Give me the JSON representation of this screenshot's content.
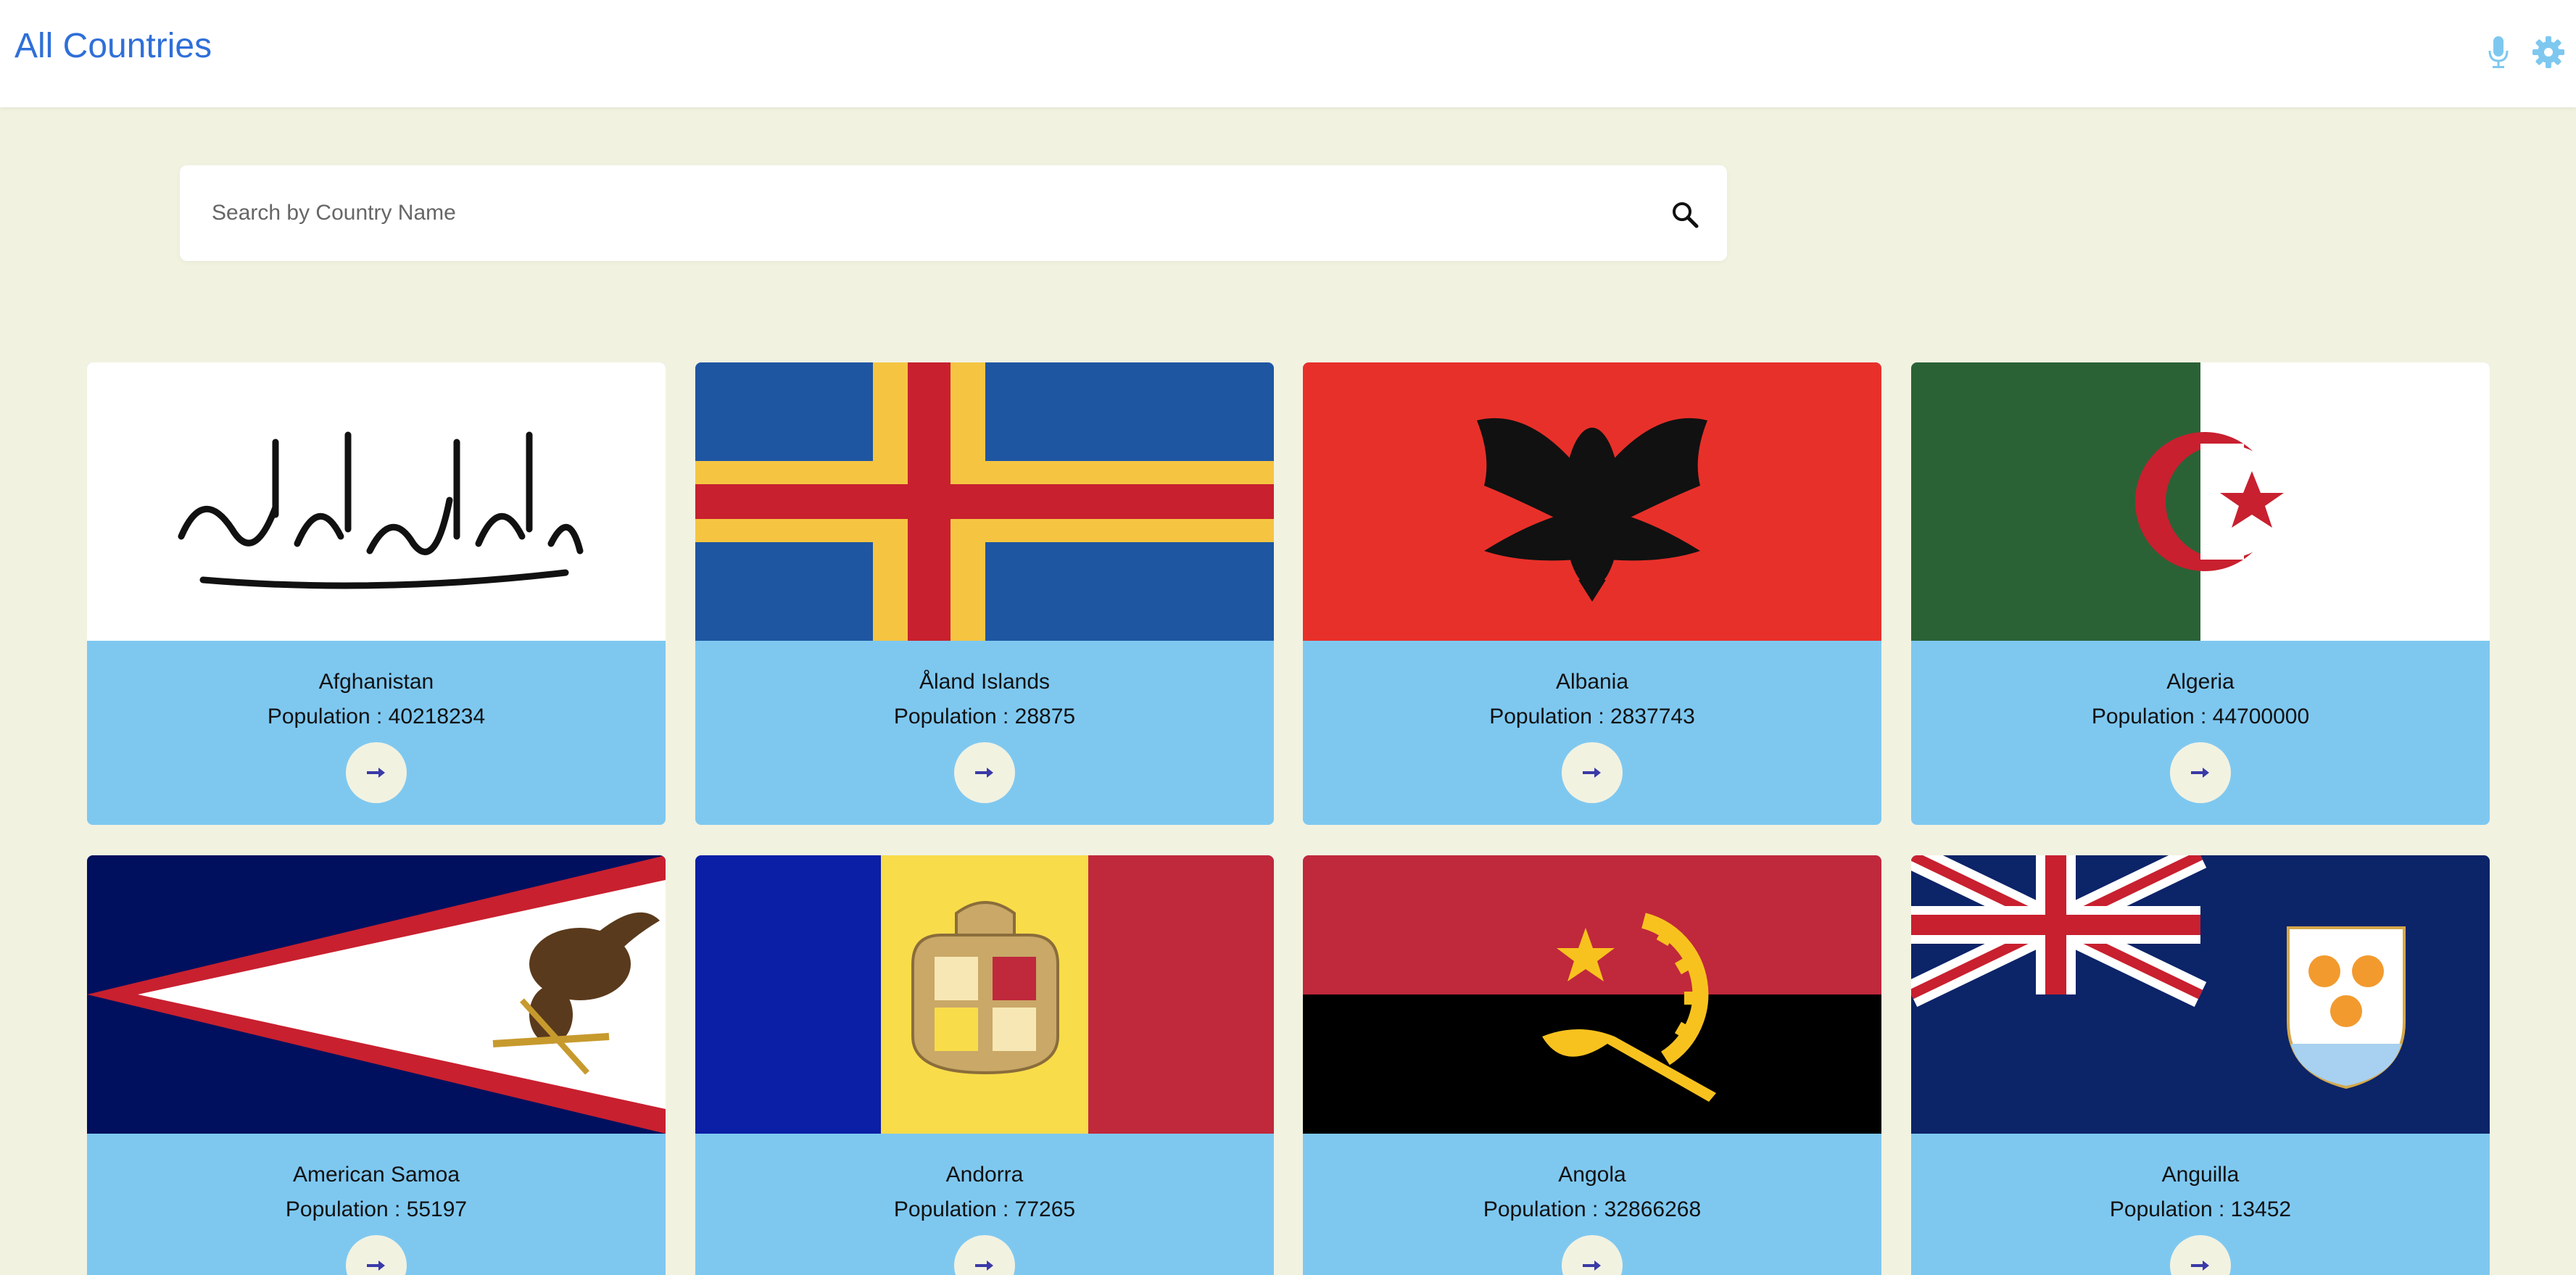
{
  "header": {
    "title": "All Countries",
    "icons": [
      "mic-icon",
      "gear-icon"
    ]
  },
  "search": {
    "placeholder": "Search by Country Name",
    "value": ""
  },
  "colors": {
    "accent": "#2f6fd8",
    "card_bg": "#7ec8f0",
    "page_bg": "#f2f2e1"
  },
  "countries": [
    {
      "name": "Afghanistan",
      "population": "Population : 40218234"
    },
    {
      "name": "Åland Islands",
      "population": "Population : 28875"
    },
    {
      "name": "Albania",
      "population": "Population : 2837743"
    },
    {
      "name": "Algeria",
      "population": "Population : 44700000"
    },
    {
      "name": "American Samoa",
      "population": "Population : 55197"
    },
    {
      "name": "Andorra",
      "population": "Population : 77265"
    },
    {
      "name": "Angola",
      "population": "Population : 32866268"
    },
    {
      "name": "Anguilla",
      "population": "Population : 13452"
    }
  ]
}
